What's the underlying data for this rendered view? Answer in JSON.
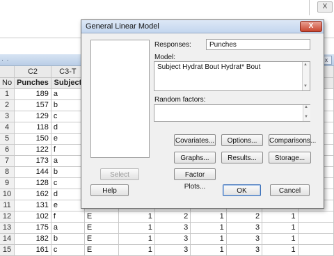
{
  "worksheet": {
    "headers_c": [
      "C2",
      "C3-T"
    ],
    "headers_n": [
      "No",
      "Punches",
      "Subject"
    ],
    "rows": [
      {
        "no": "1",
        "punches": "189",
        "subject": "a",
        "c4": "",
        "c5": "",
        "c6": "",
        "c7": "",
        "c8": "",
        "c9": ""
      },
      {
        "no": "2",
        "punches": "157",
        "subject": "b",
        "c4": "",
        "c5": "",
        "c6": "",
        "c7": "",
        "c8": "",
        "c9": ""
      },
      {
        "no": "3",
        "punches": "129",
        "subject": "c",
        "c4": "",
        "c5": "",
        "c6": "",
        "c7": "",
        "c8": "",
        "c9": ""
      },
      {
        "no": "4",
        "punches": "118",
        "subject": "d",
        "c4": "",
        "c5": "",
        "c6": "",
        "c7": "",
        "c8": "",
        "c9": ""
      },
      {
        "no": "5",
        "punches": "150",
        "subject": "e",
        "c4": "",
        "c5": "",
        "c6": "",
        "c7": "",
        "c8": "",
        "c9": ""
      },
      {
        "no": "6",
        "punches": "122",
        "subject": "f",
        "c4": "",
        "c5": "",
        "c6": "",
        "c7": "",
        "c8": "",
        "c9": ""
      },
      {
        "no": "7",
        "punches": "173",
        "subject": "a",
        "c4": "",
        "c5": "",
        "c6": "",
        "c7": "",
        "c8": "",
        "c9": ""
      },
      {
        "no": "8",
        "punches": "144",
        "subject": "b",
        "c4": "",
        "c5": "",
        "c6": "",
        "c7": "",
        "c8": "",
        "c9": ""
      },
      {
        "no": "9",
        "punches": "128",
        "subject": "c",
        "c4": "",
        "c5": "",
        "c6": "",
        "c7": "",
        "c8": "",
        "c9": ""
      },
      {
        "no": "10",
        "punches": "162",
        "subject": "d",
        "c4": "",
        "c5": "",
        "c6": "",
        "c7": "",
        "c8": "",
        "c9": ""
      },
      {
        "no": "11",
        "punches": "131",
        "subject": "e",
        "c4": "",
        "c5": "",
        "c6": "",
        "c7": "",
        "c8": "",
        "c9": ""
      },
      {
        "no": "12",
        "punches": "102",
        "subject": "f",
        "c4": "E",
        "c5": "1",
        "c6": "2",
        "c7": "1",
        "c8": "2",
        "c9": "1"
      },
      {
        "no": "13",
        "punches": "175",
        "subject": "a",
        "c4": "E",
        "c5": "1",
        "c6": "3",
        "c7": "1",
        "c8": "3",
        "c9": "1"
      },
      {
        "no": "14",
        "punches": "182",
        "subject": "b",
        "c4": "E",
        "c5": "1",
        "c6": "3",
        "c7": "1",
        "c8": "3",
        "c9": "1"
      },
      {
        "no": "15",
        "punches": "161",
        "subject": "c",
        "c4": "E",
        "c5": "1",
        "c6": "3",
        "c7": "1",
        "c8": "3",
        "c9": "1"
      }
    ]
  },
  "dialog": {
    "title": "General Linear Model",
    "close_label": "X",
    "responses_label": "Responses:",
    "responses_value": "Punches",
    "model_label": "Model:",
    "model_value": "Subject Hydrat Bout Hydrat* Bout",
    "random_label": "Random factors:",
    "random_value": "",
    "select_label": "Select",
    "help_label": "Help",
    "ok_label": "OK",
    "cancel_label": "Cancel",
    "buttons": {
      "covariates": "Covariates...",
      "options": "Options...",
      "comparisons": "Comparisons...",
      "graphs": "Graphs...",
      "results": "Results...",
      "storage": "Storage...",
      "factor_plots": "Factor Plots..."
    }
  },
  "titlebar": {
    "close_glyph": "X",
    "dots": "· ·",
    "min_glyph": "_",
    "close2_glyph": "x"
  }
}
